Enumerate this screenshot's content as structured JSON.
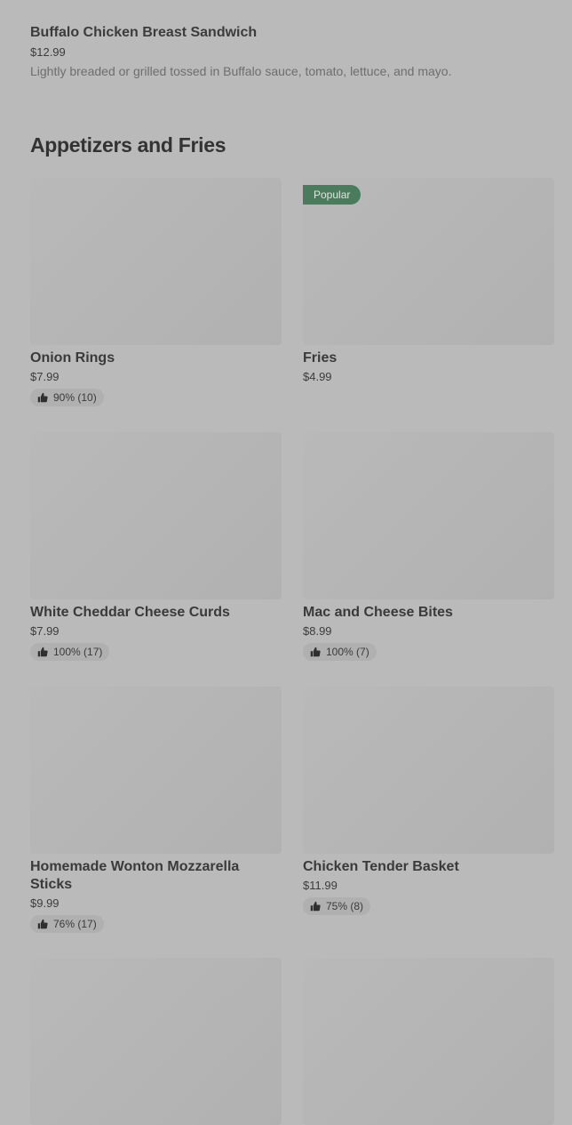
{
  "top_item": {
    "name": "Buffalo Chicken Breast Sandwich",
    "price": "$12.99",
    "description": "Lightly breaded or grilled tossed in Buffalo sauce, tomato, lettuce, and mayo."
  },
  "section": {
    "title": "Appetizers and Fries"
  },
  "items": [
    {
      "name": "Onion Rings",
      "price": "$7.99",
      "rating": "90% (10)"
    },
    {
      "name": "Fries",
      "price": "$4.99",
      "badge": "Popular"
    },
    {
      "name": "White Cheddar Cheese Curds",
      "price": "$7.99",
      "rating": "100% (17)"
    },
    {
      "name": "Mac and Cheese Bites",
      "price": "$8.99",
      "rating": "100% (7)"
    },
    {
      "name": "Homemade Wonton Mozzarella Sticks",
      "price": "$9.99",
      "rating": "76% (17)"
    },
    {
      "name": "Chicken Tender Basket",
      "price": "$11.99",
      "rating": "75% (8)"
    }
  ]
}
